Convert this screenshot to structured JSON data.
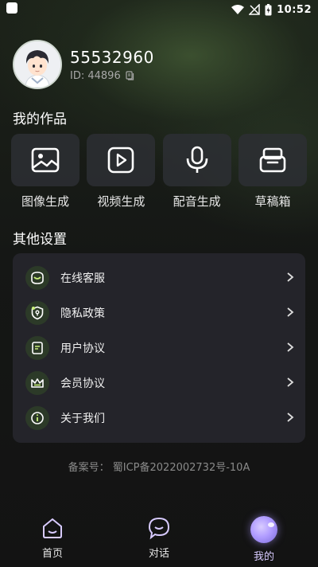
{
  "status_bar": {
    "time": "10:52",
    "icons": [
      "wifi-icon",
      "signal-off-icon",
      "battery-charging-icon"
    ]
  },
  "profile": {
    "username": "55532960",
    "id_text": "ID: 44896"
  },
  "works_section": {
    "title": "我的作品",
    "items": [
      {
        "label": "图像生成",
        "icon": "image-icon"
      },
      {
        "label": "视频生成",
        "icon": "video-play-icon"
      },
      {
        "label": "配音生成",
        "icon": "microphone-icon"
      },
      {
        "label": "草稿箱",
        "icon": "drafts-box-icon"
      }
    ]
  },
  "settings_section": {
    "title": "其他设置",
    "items": [
      {
        "label": "在线客服",
        "icon": "customer-service-icon"
      },
      {
        "label": "隐私政策",
        "icon": "privacy-shield-icon"
      },
      {
        "label": "用户协议",
        "icon": "document-icon"
      },
      {
        "label": "会员协议",
        "icon": "crown-icon"
      },
      {
        "label": "关于我们",
        "icon": "info-icon"
      }
    ]
  },
  "footer": {
    "icp": "备案号： 蜀ICP备2022002732号-10A"
  },
  "tabbar": {
    "tabs": [
      {
        "label": "首页",
        "icon": "home-icon",
        "active": false
      },
      {
        "label": "对话",
        "icon": "chat-bubble-icon",
        "active": false
      },
      {
        "label": "我的",
        "icon": "profile-orb-icon",
        "active": true
      }
    ]
  },
  "colors": {
    "accent": "#c9f07a",
    "active_tab": "#d8cbff",
    "card": "#26262c"
  }
}
